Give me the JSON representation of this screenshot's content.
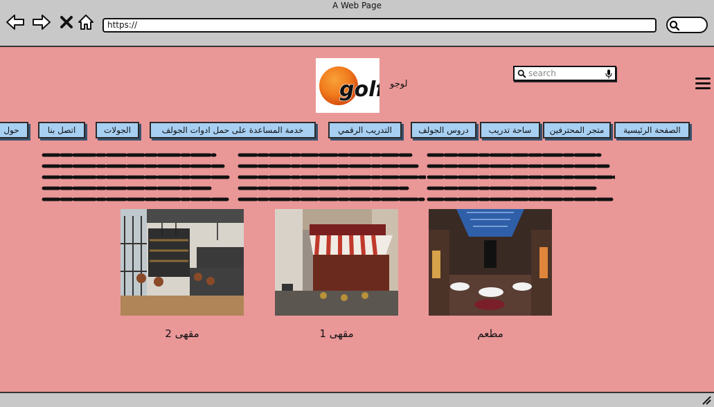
{
  "browser": {
    "title": "A Web Page",
    "url": "https://"
  },
  "header": {
    "logo_text": "golf",
    "logo_label": "لوجو",
    "search_placeholder": "search"
  },
  "nav": {
    "items": [
      "الصفحة الرئيسية",
      "متجر المحترفين",
      "ساحة تدريب",
      "دروس الجولف",
      "التدريب الرقمي",
      "خدمة المساعدة على حمل ادوات الجولف",
      "الجولات",
      "اتصل بنا",
      "حول"
    ]
  },
  "cards": [
    {
      "caption": "مطعم",
      "image": "restaurant-photo"
    },
    {
      "caption": "مقهى 1",
      "image": "cafe-street-photo"
    },
    {
      "caption": "مقهى 2",
      "image": "cafe-interior-photo"
    }
  ],
  "colors": {
    "page_bg": "#ea9798",
    "nav_button": "#a7cff2",
    "chrome": "#c8c8c8"
  }
}
